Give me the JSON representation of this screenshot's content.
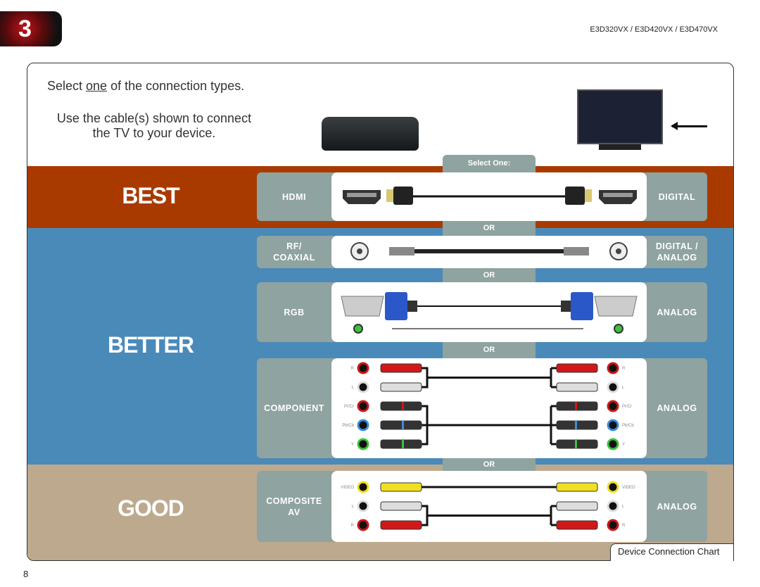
{
  "header": {
    "chapter_number": "3",
    "models": "E3D320VX / E3D420VX / E3D470VX"
  },
  "instructions": {
    "line1_pre": "Select ",
    "line1_emph": "one",
    "line1_post": " of the connection types.",
    "line2": "Use the cable(s) shown to connect",
    "line3": "the TV to your device."
  },
  "tabs": {
    "select_one": "Select One:",
    "or": "OR"
  },
  "tiers": [
    {
      "label": "BEST",
      "color": "#a83a00"
    },
    {
      "label": "BETTER",
      "color": "#4a8ab9"
    },
    {
      "label": "GOOD",
      "color": "#bda98d"
    }
  ],
  "connections": [
    {
      "name": "HDMI",
      "type": "DIGITAL"
    },
    {
      "name": "RF/ COAXIAL",
      "type": "DIGITAL / ANALOG"
    },
    {
      "name": "RGB",
      "type": "ANALOG"
    },
    {
      "name": "COMPONENT",
      "type": "ANALOG",
      "jacks": [
        {
          "label": "R",
          "color": "#d01818"
        },
        {
          "label": "L",
          "color": "#dddddd"
        },
        {
          "label": "Pr/Cr",
          "color": "#d01818"
        },
        {
          "label": "Pb/Cb",
          "color": "#3a8de0"
        },
        {
          "label": "Y",
          "color": "#3cc23c"
        }
      ]
    },
    {
      "name": "COMPOSITE AV",
      "type": "ANALOG",
      "jacks": [
        {
          "label": "VIDEO",
          "color": "#f0e020"
        },
        {
          "label": "L",
          "color": "#dddddd"
        },
        {
          "label": "R",
          "color": "#d01818"
        }
      ]
    }
  ],
  "footer": {
    "chart_title": "Device Connection Chart",
    "page_number": "8"
  }
}
